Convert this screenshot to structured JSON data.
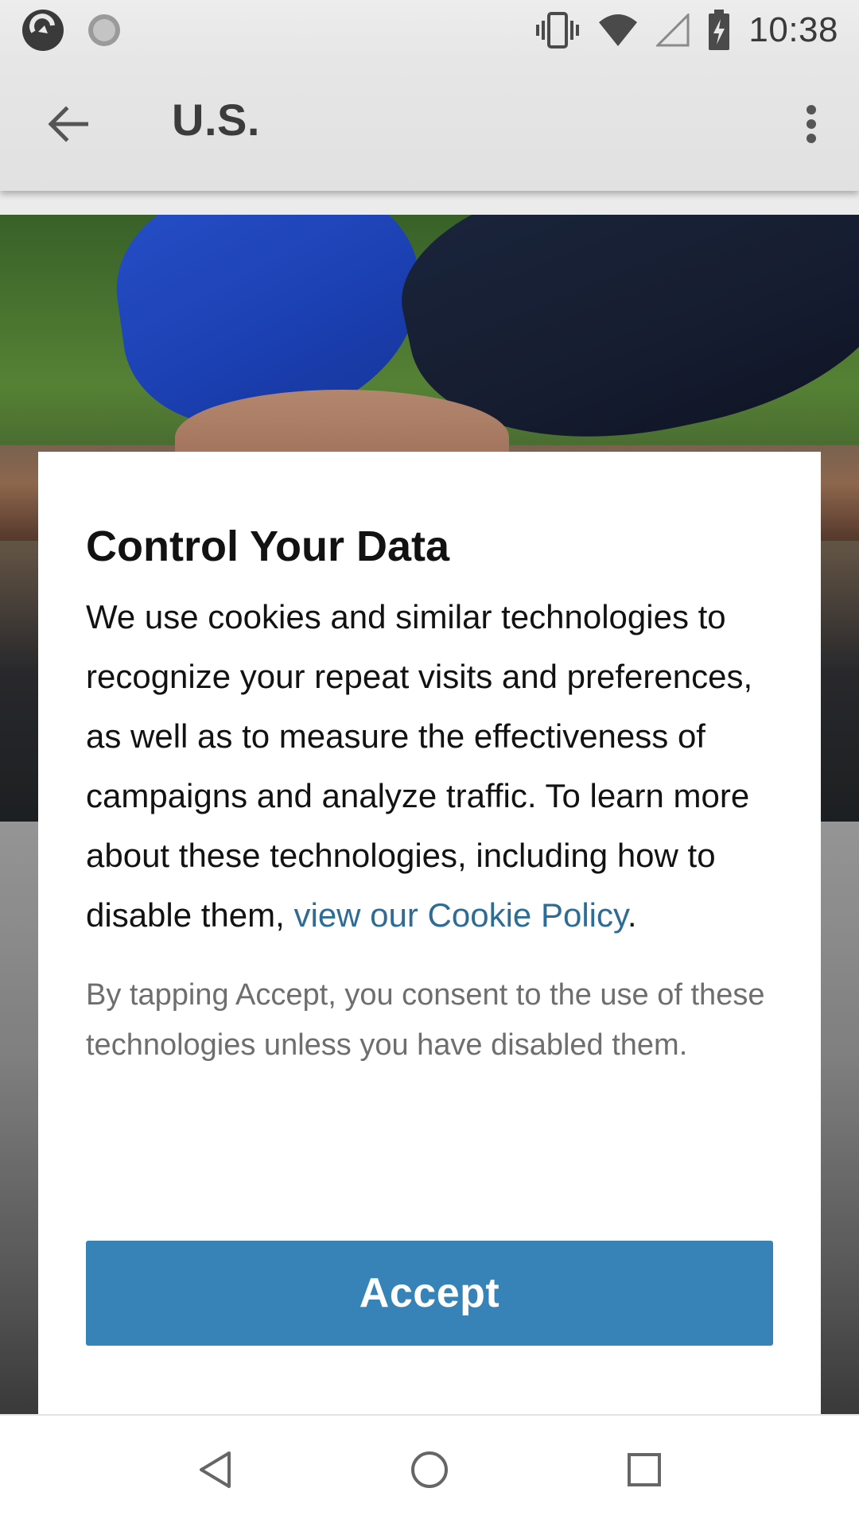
{
  "status_bar": {
    "time": "10:38",
    "icons": [
      "app-notification-icon",
      "sync-notification-icon",
      "vibrate-icon",
      "wifi-icon",
      "cell-signal-icon",
      "battery-charging-icon"
    ]
  },
  "toolbar": {
    "title": "U.S.",
    "back_icon": "arrow-back-icon",
    "menu_icon": "more-vert-icon"
  },
  "dialog": {
    "title": "Control Your Data",
    "body_text": "We use cookies and similar technologies to recognize your repeat visits and preferences, as well as to measure the effectiveness of campaigns and analyze traffic. To learn more about these technologies, including how to disable them, ",
    "policy_link": "view our Cookie Policy",
    "body_end": ".",
    "consent_text": "By tapping Accept, you consent to the use of these technologies unless you have disabled them.",
    "accept_label": "Accept"
  },
  "colors": {
    "accent": "#3783b7",
    "link": "#2e6b95"
  },
  "nav_bar": {
    "icons": [
      "nav-back-icon",
      "nav-home-icon",
      "nav-recents-icon"
    ]
  }
}
